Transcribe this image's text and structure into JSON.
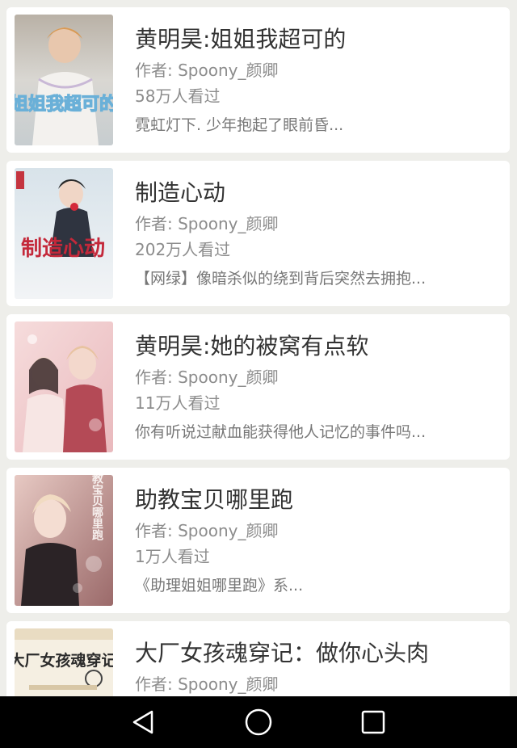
{
  "books": [
    {
      "title": "黄明昊:姐姐我超可的",
      "author": "作者: Spoony_颜卿",
      "views": "58万人看过",
      "desc": "霓虹灯下. 少年抱起了眼前昏...",
      "cover_text": "姐姐我超可的"
    },
    {
      "title": "制造心动",
      "author": "作者: Spoony_颜卿",
      "views": "202万人看过",
      "desc": "【网绿】像暗杀似的绕到背后突然去拥抱...",
      "cover_text": "制造心动"
    },
    {
      "title": "黄明昊:她的被窝有点软",
      "author": "作者: Spoony_颜卿",
      "views": "11万人看过",
      "desc": "你有听说过献血能获得他人记忆的事件吗...",
      "cover_text": ""
    },
    {
      "title": "助教宝贝哪里跑",
      "author": "作者: Spoony_颜卿",
      "views": "1万人看过",
      "desc": "《助理姐姐哪里跑》系...",
      "cover_text": "助教宝贝哪里跑"
    },
    {
      "title": "大厂女孩魂穿记：做你心头肉",
      "author": "作者: Spoony_颜卿",
      "views": "",
      "desc": "",
      "cover_text": "大厂女孩魂穿记"
    }
  ],
  "nav": {
    "back_icon": "back-triangle-icon",
    "home_icon": "home-circle-icon",
    "recents_icon": "recents-square-icon"
  }
}
